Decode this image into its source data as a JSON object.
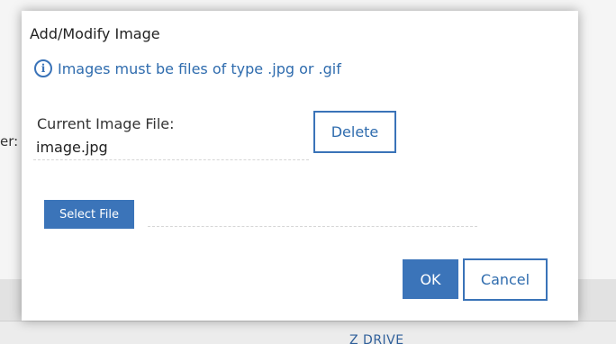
{
  "background": {
    "left_label": "er:",
    "bottom_label": "Z DRIVE"
  },
  "dialog": {
    "title": "Add/Modify Image",
    "info_icon": "info-icon",
    "info_text": "Images must be files of type .jpg or .gif",
    "current_label": "Current Image File:",
    "current_value": "image.jpg",
    "delete_label": "Delete",
    "select_file_label": "Select File",
    "ok_label": "OK",
    "cancel_label": "Cancel"
  },
  "colors": {
    "accent": "#3b74b9",
    "link_text": "#2f6cae",
    "modal_bg": "#ffffff"
  }
}
